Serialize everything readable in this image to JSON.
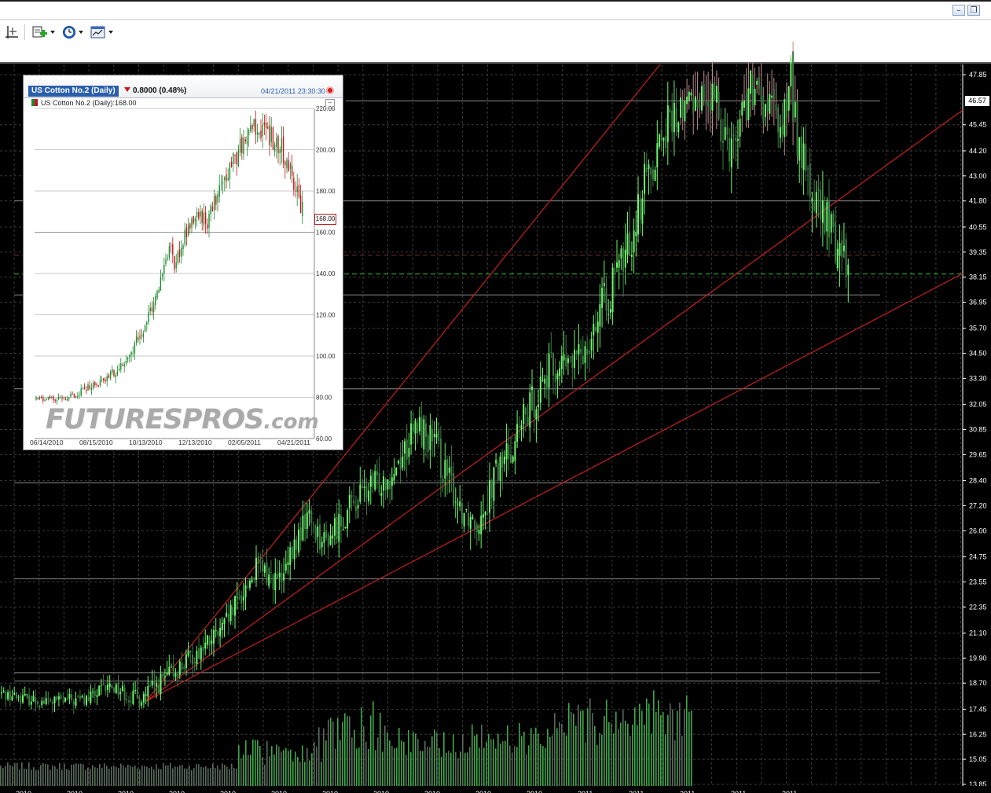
{
  "window": {
    "minimize_icon": "minimize-icon",
    "restore_icon": "restore-icon",
    "minimize_glyph": "–",
    "restore_glyph": "❐"
  },
  "toolbar": {
    "buttons": [
      {
        "icon": "crosshair-icon"
      },
      {
        "icon": "add-chart-icon"
      },
      {
        "icon": "clock-icon"
      },
      {
        "icon": "chart-template-icon"
      }
    ]
  },
  "main_chart": {
    "current_price": "46.57",
    "price_ticks": [
      "47.85",
      "45.45",
      "44.20",
      "43.00",
      "41.80",
      "40.55",
      "39.35",
      "38.15",
      "36.95",
      "35.70",
      "34.50",
      "33.30",
      "32.05",
      "30.85",
      "29.65",
      "28.40",
      "27.20",
      "26.00",
      "24.75",
      "23.55",
      "22.35",
      "21.10",
      "19.90",
      "18.70",
      "17.45",
      "16.25",
      "15.05",
      "13.85"
    ],
    "date_ticks": [
      "2010",
      "2010",
      "2010",
      "2010",
      "2010",
      "2010",
      "2010",
      "2010",
      "2010",
      "2010",
      "2010",
      "2011",
      "2011",
      "2011",
      "2011",
      "2011"
    ],
    "colors": {
      "bull": "#6cf56c",
      "bear": "#3f7a47",
      "wick_top": "#b98d8d",
      "trend": "#c81d1d",
      "level": "#8c8c8c",
      "grid": "#3a3a3a",
      "dashed_green": "#2fc02f",
      "dashed_red": "#7a2a2a"
    }
  },
  "inset": {
    "tab": "US Cotton No.2 (Daily)",
    "change": "0.8000 (0.48%)",
    "timestamp": "04/21/2011 23:30:30",
    "series": "US Cotton No.2 (Daily):168.00",
    "price_label": "168.00",
    "y_ticks": [
      "220.00",
      "200.00",
      "180.00",
      "160.00",
      "140.00",
      "120.00",
      "100.00",
      "80.00",
      "60.00"
    ],
    "x_ticks": [
      "06/14/2010",
      "08/15/2010",
      "10/13/2010",
      "12/13/2010",
      "02/05/2011",
      "04/21/2011"
    ],
    "watermark_main": "FUTURESPROS",
    "watermark_suffix": ".com",
    "colors": {
      "up": "#1b8c2c",
      "down": "#c3161c",
      "grid": "#c8c8c8"
    }
  },
  "chart_data": [
    {
      "type": "candlestick",
      "series_price_range": [
        17.0,
        48.5
      ],
      "ylim": [
        13.85,
        48.5
      ],
      "grid": true,
      "y_ticks": [
        47.85,
        45.45,
        44.2,
        43.0,
        41.8,
        40.55,
        39.35,
        38.15,
        36.95,
        35.7,
        34.5,
        33.3,
        32.05,
        30.85,
        29.65,
        28.4,
        27.2,
        26.0,
        24.75,
        23.55,
        22.35,
        21.1,
        19.9,
        18.7,
        17.45,
        16.25,
        15.05,
        13.85
      ],
      "last_price": 46.57,
      "horizontal_levels": [
        46.6,
        41.8,
        39.2,
        38.3,
        37.3,
        32.8,
        28.3,
        23.7,
        19.2,
        18.8
      ],
      "path_points": [
        [
          0,
          18.2
        ],
        [
          0.05,
          17.8
        ],
        [
          0.1,
          17.9
        ],
        [
          0.13,
          18.6
        ],
        [
          0.16,
          17.9
        ],
        [
          0.18,
          18.5
        ],
        [
          0.22,
          19.8
        ],
        [
          0.26,
          21.2
        ],
        [
          0.3,
          24.2
        ],
        [
          0.33,
          23.5
        ],
        [
          0.36,
          26.8
        ],
        [
          0.38,
          25.4
        ],
        [
          0.42,
          27.6
        ],
        [
          0.46,
          28.8
        ],
        [
          0.49,
          31.0
        ],
        [
          0.51,
          30.2
        ],
        [
          0.52,
          29.0
        ],
        [
          0.54,
          27.2
        ],
        [
          0.56,
          26.5
        ],
        [
          0.58,
          28.5
        ],
        [
          0.6,
          30.0
        ],
        [
          0.62,
          31.6
        ],
        [
          0.64,
          33.5
        ],
        [
          0.66,
          33.9
        ],
        [
          0.68,
          34.2
        ],
        [
          0.7,
          36.1
        ],
        [
          0.72,
          37.7
        ],
        [
          0.74,
          39.8
        ],
        [
          0.76,
          43.0
        ],
        [
          0.78,
          45.2
        ],
        [
          0.8,
          46.0
        ],
        [
          0.82,
          47.0
        ],
        [
          0.84,
          46.5
        ],
        [
          0.86,
          44.5
        ],
        [
          0.88,
          47.0
        ],
        [
          0.9,
          46.3
        ],
        [
          0.92,
          45.5
        ],
        [
          0.93,
          47.5
        ],
        [
          0.94,
          44.2
        ],
        [
          0.96,
          41.5
        ],
        [
          0.98,
          40.2
        ],
        [
          1,
          38.6
        ]
      ]
    },
    {
      "type": "candlestick",
      "title": "US Cotton No.2 (Daily)",
      "x": [
        "06/14/2010",
        "08/15/2010",
        "10/13/2010",
        "12/13/2010",
        "02/05/2011",
        "04/21/2011"
      ],
      "ylim": [
        60,
        220
      ],
      "last_value": 168.0,
      "change": "0.8000 (0.48%)",
      "path_points": [
        [
          0,
          79
        ],
        [
          0.08,
          79
        ],
        [
          0.15,
          82
        ],
        [
          0.25,
          88
        ],
        [
          0.32,
          95
        ],
        [
          0.4,
          112
        ],
        [
          0.45,
          128
        ],
        [
          0.5,
          155
        ],
        [
          0.52,
          143
        ],
        [
          0.56,
          160
        ],
        [
          0.6,
          170
        ],
        [
          0.64,
          165
        ],
        [
          0.68,
          178
        ],
        [
          0.72,
          190
        ],
        [
          0.78,
          205
        ],
        [
          0.82,
          212
        ],
        [
          0.86,
          208
        ],
        [
          0.88,
          206
        ],
        [
          0.92,
          200
        ],
        [
          0.95,
          192
        ],
        [
          0.98,
          176
        ],
        [
          1,
          168
        ]
      ]
    }
  ]
}
